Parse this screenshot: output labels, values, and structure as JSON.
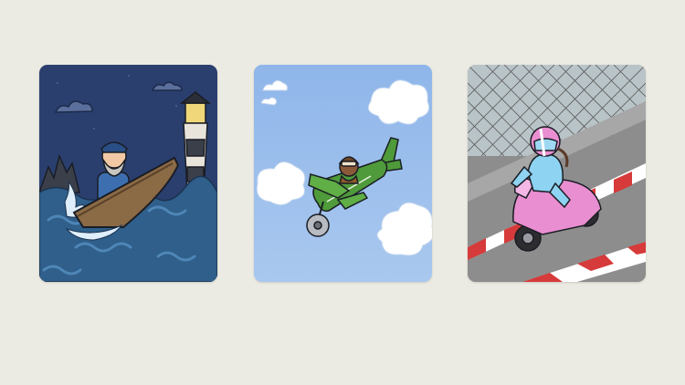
{
  "cards": [
    {
      "scene": "fisherman-boat-storm",
      "colors": {
        "sky": "#2a3f6e",
        "sea": "#2f5f8a",
        "boat": "#8b6a46"
      }
    },
    {
      "scene": "pilot-green-airplane",
      "colors": {
        "sky": "#8fb6ea",
        "plane": "#4f9a3a",
        "cloud": "#ffffff"
      }
    },
    {
      "scene": "rider-pink-motorbike",
      "colors": {
        "road": "#8d8d8d",
        "bike": "#e98ed0",
        "suit": "#8fd3f2"
      }
    }
  ]
}
